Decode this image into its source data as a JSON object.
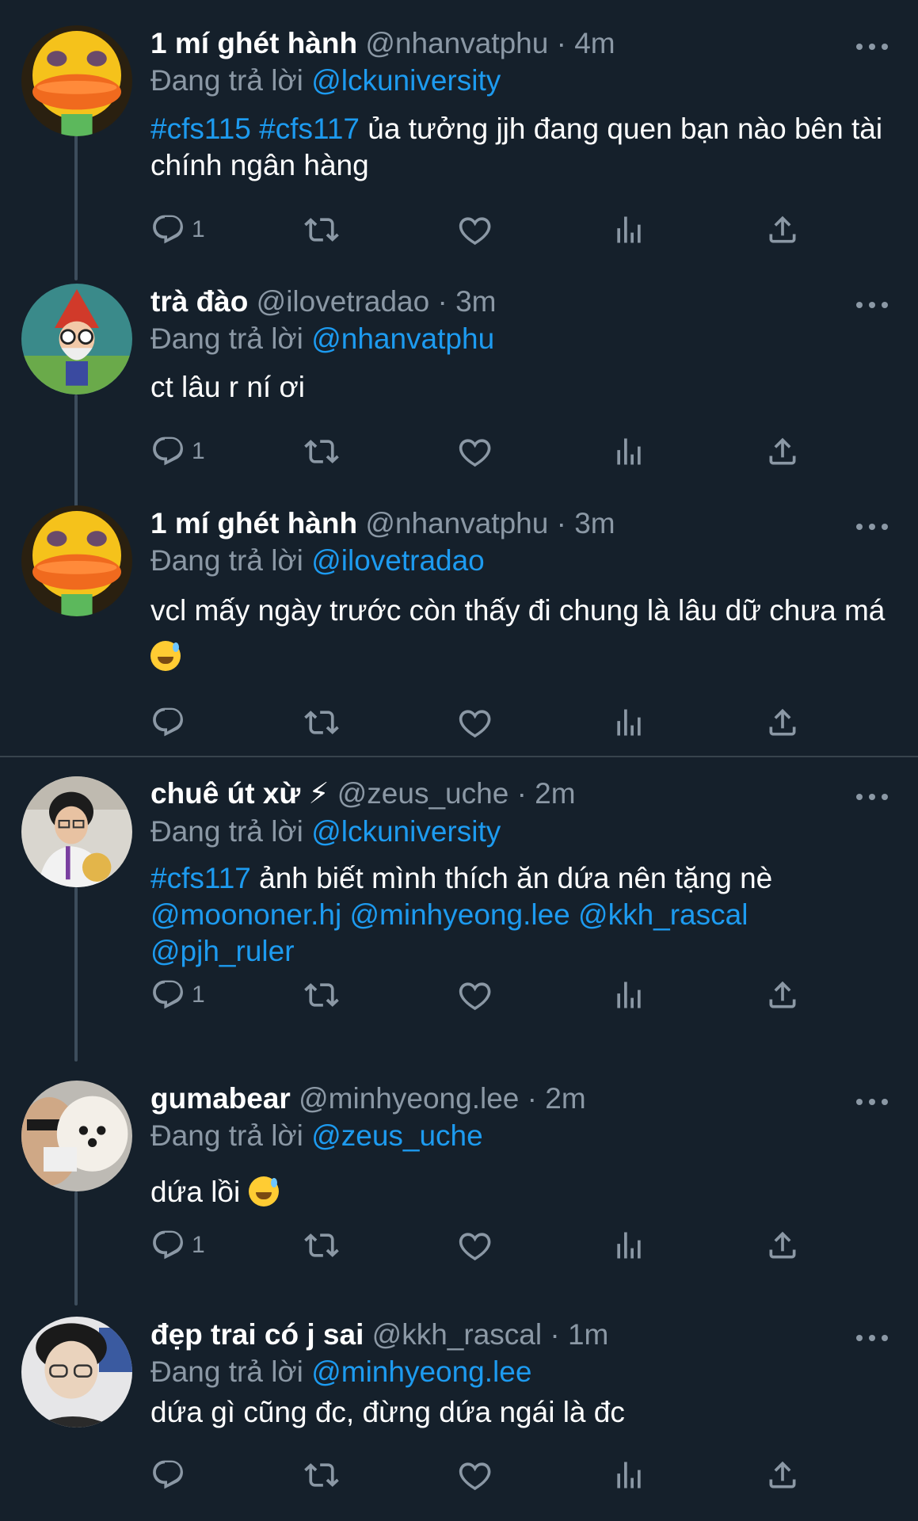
{
  "colors": {
    "background": "#15202b",
    "accent": "#1d9bf0",
    "muted": "#8b98a5",
    "thread_line": "#3d4d5c"
  },
  "reply_prefix": "Đang trả lời",
  "tweets": [
    {
      "display_name": "1 mí ghét hành",
      "handle": "@nhanvatphu",
      "time": "· 4m",
      "replying_to": "@lckuniversity",
      "tag1": "#cfs115",
      "tag2": "#cfs117",
      "text": "ủa tưởng jjh đang quen bạn nào bên tài chính ngân hàng",
      "reply_count": "1"
    },
    {
      "display_name": "trà đào",
      "handle": "@ilovetradao",
      "time": "· 3m",
      "replying_to": "@nhanvatphu",
      "text": "ct lâu r ní ơi",
      "reply_count": "1"
    },
    {
      "display_name": "1 mí ghét hành",
      "handle": "@nhanvatphu",
      "time": "· 3m",
      "replying_to": "@ilovetradao",
      "text": "vcl mấy ngày trước còn thấy đi chung là lâu dữ chưa má",
      "emoji": "sweat-smile-emoji",
      "reply_count": ""
    },
    {
      "display_name": "chuê út xừ ⚡",
      "handle": "@zeus_uche",
      "time": "· 2m",
      "replying_to": "@lckuniversity",
      "tag1": "#cfs117",
      "text": "ảnh biết mình thích ăn dứa nên tặng nè",
      "mention1": "@moononer.hj",
      "mention2": "@minhyeong.lee",
      "mention3": "@kkh_rascal",
      "mention4": "@pjh_ruler",
      "reply_count": "1"
    },
    {
      "display_name": "gumabear",
      "handle": "@minhyeong.lee",
      "time": "· 2m",
      "replying_to": "@zeus_uche",
      "text": "dứa lồi",
      "emoji": "sweat-smile-emoji",
      "reply_count": "1"
    },
    {
      "display_name": "đẹp trai có j sai",
      "handle": "@kkh_rascal",
      "time": "· 1m",
      "replying_to": "@minhyeong.lee",
      "text": "dứa gì cũng đc, đừng dứa ngái là đc",
      "reply_count": ""
    }
  ],
  "icons": [
    "reply-icon",
    "retweet-icon",
    "like-icon",
    "views-icon",
    "share-icon",
    "more-icon"
  ]
}
